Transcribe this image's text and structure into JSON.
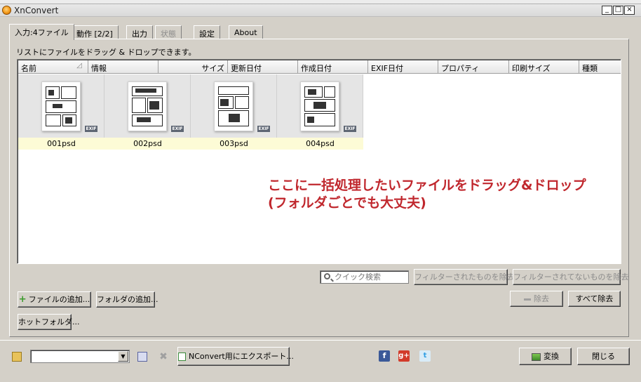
{
  "window": {
    "title": "XnConvert",
    "controls": {
      "minimize": "_",
      "maximize": "□",
      "close": "×"
    }
  },
  "tabs": [
    {
      "label": "入力:4ファイル",
      "state": "active"
    },
    {
      "label": "動作 [2/2]",
      "state": "normal"
    },
    {
      "label": "出力",
      "state": "normal"
    },
    {
      "label": "状態",
      "state": "disabled"
    },
    {
      "label": "設定",
      "state": "normal"
    },
    {
      "label": "About",
      "state": "normal"
    }
  ],
  "input_panel": {
    "hint": "リストにファイルをドラッグ & ドロップできます。",
    "columns": [
      "名前",
      "情報",
      "サイズ",
      "更新日付",
      "作成日付",
      "EXIF日付",
      "プロパティ",
      "印刷サイズ",
      "種類"
    ],
    "files": [
      {
        "name": "001psd",
        "badge": "EXIF"
      },
      {
        "name": "002psd",
        "badge": "EXIF"
      },
      {
        "name": "003psd",
        "badge": "EXIF"
      },
      {
        "name": "004psd",
        "badge": "EXIF"
      }
    ],
    "annotation": {
      "line1": "ここに一括処理したいファイルをドラッグ&ドロップ",
      "line2": "(フォルダごとでも大丈夫)",
      "color": "#c0272d"
    },
    "search": {
      "placeholder": "クイック検索",
      "value": ""
    },
    "buttons": {
      "remove_filtered": "フィルターされたものを除去",
      "remove_unfiltered": "フィルターされてないものを除去",
      "add_files": "ファイルの追加...",
      "add_folder": "フォルダの追加...",
      "remove": "除去",
      "remove_all": "すべて除去",
      "hot_folder": "ホットフォルダ..."
    }
  },
  "bottom_bar": {
    "preset_value": "",
    "export_button": "NConvert用にエクスポート...",
    "social": [
      "facebook-icon",
      "google-plus-icon",
      "twitter-icon"
    ],
    "convert_button": "変換",
    "close_button": "閉じる"
  }
}
